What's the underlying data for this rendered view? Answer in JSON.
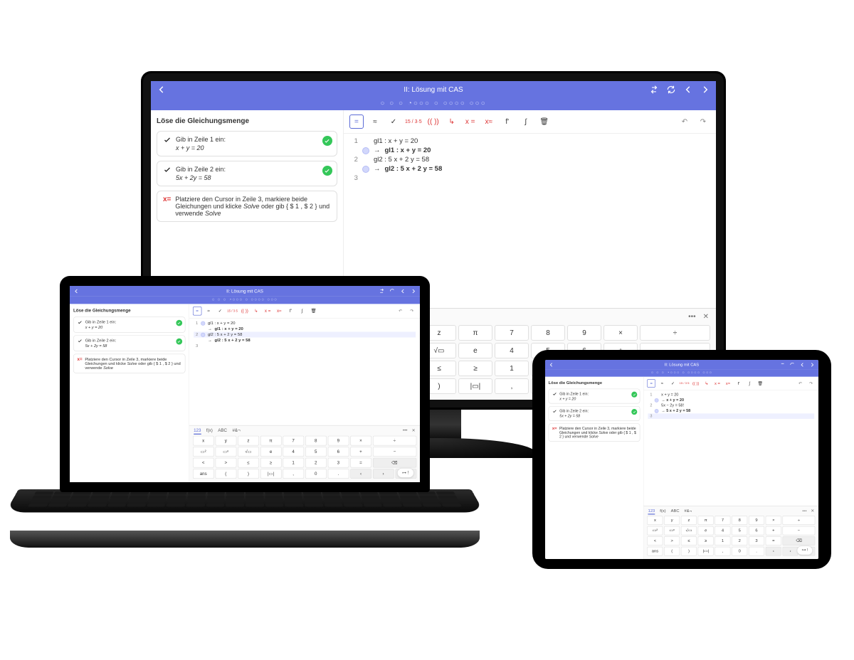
{
  "header": {
    "title": "II: Lösung mit CAS",
    "back_icon": "arrow-left",
    "tool_icons": [
      "swap",
      "refresh",
      "chevron-left",
      "chevron-right"
    ]
  },
  "progress_dots": "○ ○ ○    ◔○○○ ○ ○○○○   ○○○",
  "left": {
    "heading": "Löse die Gleichungsmenge",
    "t1": {
      "title": "Gib in Zeile 1 ein:",
      "math": "x + y = 20"
    },
    "t2": {
      "title": "Gib in Zeile 2 ein:",
      "math": "5x + 2y = 58"
    },
    "hint_prefix": "x=",
    "hint_text": "Platziere den Cursor in Zeile 3, markiere beide Gleichungen und klicke ",
    "hint_em1": "Solve",
    "hint_mid": " oder gib ",
    "hint_code": "{ $ 1 , $ 2 }",
    "hint_tail": " und verwende ",
    "hint_em2": "Solve"
  },
  "toolbar": {
    "b1": "=",
    "b2": "≈",
    "b3": "✓",
    "b4": "15 / 3·5",
    "b5": "(( ))",
    "b6": "↳",
    "b7": "x =",
    "b8": "x≈",
    "b9": "f'",
    "b10": "∫",
    "b11": "🗑",
    "undo": "↶",
    "redo": "↷"
  },
  "cas": {
    "r1": {
      "n": "1",
      "txt": "gl1 : x + y = 20"
    },
    "r1b": {
      "txt": "gl1 : x + y = 20"
    },
    "r2": {
      "n": "2",
      "txt": "gl2 : 5 x + 2 y = 58"
    },
    "r2b": {
      "txt": "gl2 : 5 x + 2 y = 58"
    },
    "r3": {
      "n": "3",
      "txt": ""
    },
    "tab_r1": {
      "n": "1",
      "txt": "x + y = 20"
    },
    "tab_r1b": {
      "txt": "→ x + y = 20"
    },
    "tab_r2": {
      "n": "2",
      "txt": "5x − 2y = 58!"
    },
    "tab_r2b": {
      "txt": "→ 5 x + 2 y = 58"
    }
  },
  "keyboard": {
    "tabs": [
      "123",
      "f(x)",
      "ABC",
      "#&¬"
    ],
    "more": "•••",
    "close": "✕",
    "k": [
      "x",
      "y",
      "z",
      "π",
      "7",
      "8",
      "9",
      "×",
      "÷",
      "▭²",
      "▭ⁿ",
      "√▭",
      "e",
      "4",
      "5",
      "6",
      "+",
      "−",
      "<",
      ">",
      "≤",
      "≥",
      "1",
      "2",
      "3",
      "=",
      "⌫",
      "(",
      ")",
      "|▭|",
      ",",
      "0",
      ".",
      "‹",
      "›",
      "⏎"
    ],
    "ans": "ans"
  },
  "fab": "⊶ !"
}
